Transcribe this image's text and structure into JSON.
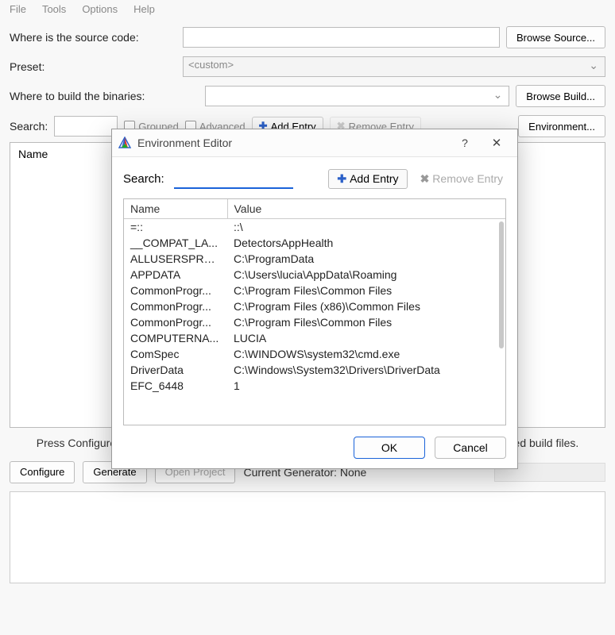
{
  "menu": {
    "file": "File",
    "tools": "Tools",
    "options": "Options",
    "help": "Help"
  },
  "labels": {
    "source": "Where is the source code:",
    "preset": "Preset:",
    "build": "Where to build the binaries:",
    "search": "Search:"
  },
  "buttons": {
    "browse_source": "Browse Source...",
    "browse_build": "Browse Build...",
    "environment": "Environment...",
    "configure": "Configure",
    "generate": "Generate",
    "open_project": "Open Project"
  },
  "preset_value": "<custom>",
  "toolbar": {
    "grouped": "Grouped",
    "advanced": "Advanced",
    "add_entry": "Add Entry",
    "remove_entry": "Remove Entry"
  },
  "cache_header": "Name",
  "hint": "Press Configure to update and display new values in red, then press Generate to generate selected build files.",
  "generator_status": "Current Generator: None",
  "dialog": {
    "title": "Environment Editor",
    "search_label": "Search:",
    "add_entry": "Add Entry",
    "remove_entry": "Remove Entry",
    "col_name": "Name",
    "col_value": "Value",
    "ok": "OK",
    "cancel": "Cancel",
    "env": [
      {
        "name": "=::",
        "value": "::\\"
      },
      {
        "name": "__COMPAT_LA...",
        "value": "DetectorsAppHealth"
      },
      {
        "name": "ALLUSERSPROF...",
        "value": "C:\\ProgramData"
      },
      {
        "name": "APPDATA",
        "value": "C:\\Users\\lucia\\AppData\\Roaming"
      },
      {
        "name": "CommonProgr...",
        "value": "C:\\Program Files\\Common Files"
      },
      {
        "name": "CommonProgr...",
        "value": "C:\\Program Files (x86)\\Common Files"
      },
      {
        "name": "CommonProgr...",
        "value": "C:\\Program Files\\Common Files"
      },
      {
        "name": "COMPUTERNA...",
        "value": "LUCIA"
      },
      {
        "name": "ComSpec",
        "value": "C:\\WINDOWS\\system32\\cmd.exe"
      },
      {
        "name": "DriverData",
        "value": "C:\\Windows\\System32\\Drivers\\DriverData"
      },
      {
        "name": "EFC_6448",
        "value": "1"
      }
    ]
  }
}
